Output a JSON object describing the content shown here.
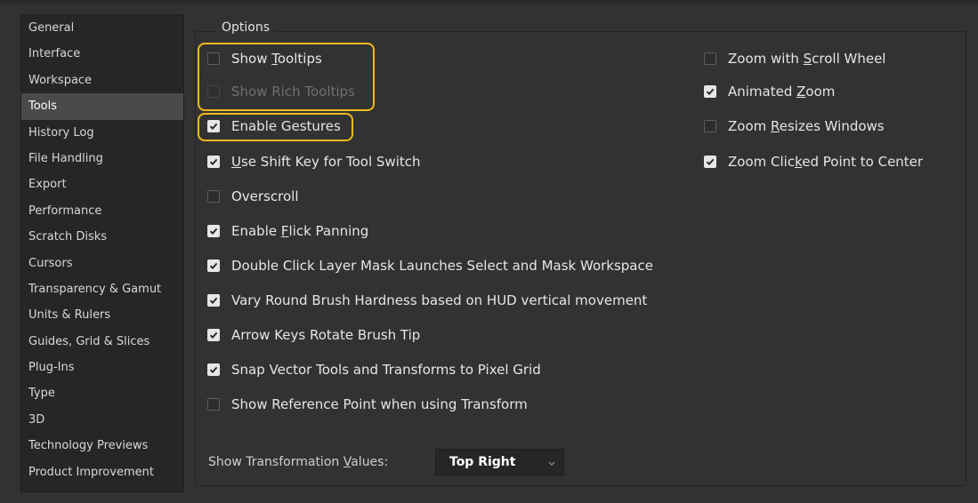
{
  "sidebar": {
    "items": [
      {
        "label": "General"
      },
      {
        "label": "Interface"
      },
      {
        "label": "Workspace"
      },
      {
        "label": "Tools",
        "active": true
      },
      {
        "label": "History Log"
      },
      {
        "label": "File Handling"
      },
      {
        "label": "Export"
      },
      {
        "label": "Performance"
      },
      {
        "label": "Scratch Disks"
      },
      {
        "label": "Cursors"
      },
      {
        "label": "Transparency & Gamut"
      },
      {
        "label": "Units & Rulers"
      },
      {
        "label": "Guides, Grid & Slices"
      },
      {
        "label": "Plug-Ins"
      },
      {
        "label": "Type"
      },
      {
        "label": "3D"
      },
      {
        "label": "Technology Previews"
      },
      {
        "label": "Product Improvement"
      }
    ]
  },
  "options": {
    "title": "Options",
    "left": [
      {
        "pre": "Show ",
        "ul": "T",
        "post": "ooltips",
        "checked": false,
        "disabled": false
      },
      {
        "pre": "Show Rich Tooltips",
        "ul": "",
        "post": "",
        "checked": false,
        "disabled": true
      },
      {
        "pre": "Enable Gestures",
        "ul": "",
        "post": "",
        "checked": true,
        "disabled": false
      },
      {
        "pre": "",
        "ul": "U",
        "post": "se Shift Key for Tool Switch",
        "checked": true,
        "disabled": false
      },
      {
        "pre": "Overscroll",
        "ul": "",
        "post": "",
        "checked": false,
        "disabled": false
      },
      {
        "pre": "Enable ",
        "ul": "F",
        "post": "lick Panning",
        "checked": true,
        "disabled": false
      },
      {
        "pre": "Double Click Layer Mask Launches Select and Mask Workspace",
        "ul": "",
        "post": "",
        "checked": true,
        "disabled": false
      },
      {
        "pre": "Vary Round Brush Hardness based on HUD vertical movement",
        "ul": "",
        "post": "",
        "checked": true,
        "disabled": false
      },
      {
        "pre": "Arrow Keys Rotate Brush Tip",
        "ul": "",
        "post": "",
        "checked": true,
        "disabled": false
      },
      {
        "pre": "Snap Vector Tools and Transforms to Pixel Grid",
        "ul": "",
        "post": "",
        "checked": true,
        "disabled": false
      },
      {
        "pre": "Show Reference Point when using Transform",
        "ul": "",
        "post": "",
        "checked": false,
        "disabled": false
      }
    ],
    "right": [
      {
        "pre": "Zoom with ",
        "ul": "S",
        "post": "croll Wheel",
        "checked": false,
        "disabled": false
      },
      {
        "pre": "Animated ",
        "ul": "Z",
        "post": "oom",
        "checked": true,
        "disabled": false
      },
      {
        "pre": "Zoom ",
        "ul": "R",
        "post": "esizes Windows",
        "checked": false,
        "disabled": false
      },
      {
        "pre": "Zoom Clic",
        "ul": "k",
        "post": "ed Point to Center",
        "checked": true,
        "disabled": false
      }
    ]
  },
  "transform_values": {
    "label_pre": "Show Transformation ",
    "label_ul": "V",
    "label_post": "alues:",
    "selected": "Top Right"
  },
  "colors": {
    "highlight": "#f2b91c",
    "background": "#323232",
    "sidebar_active": "#4a4a4a"
  }
}
